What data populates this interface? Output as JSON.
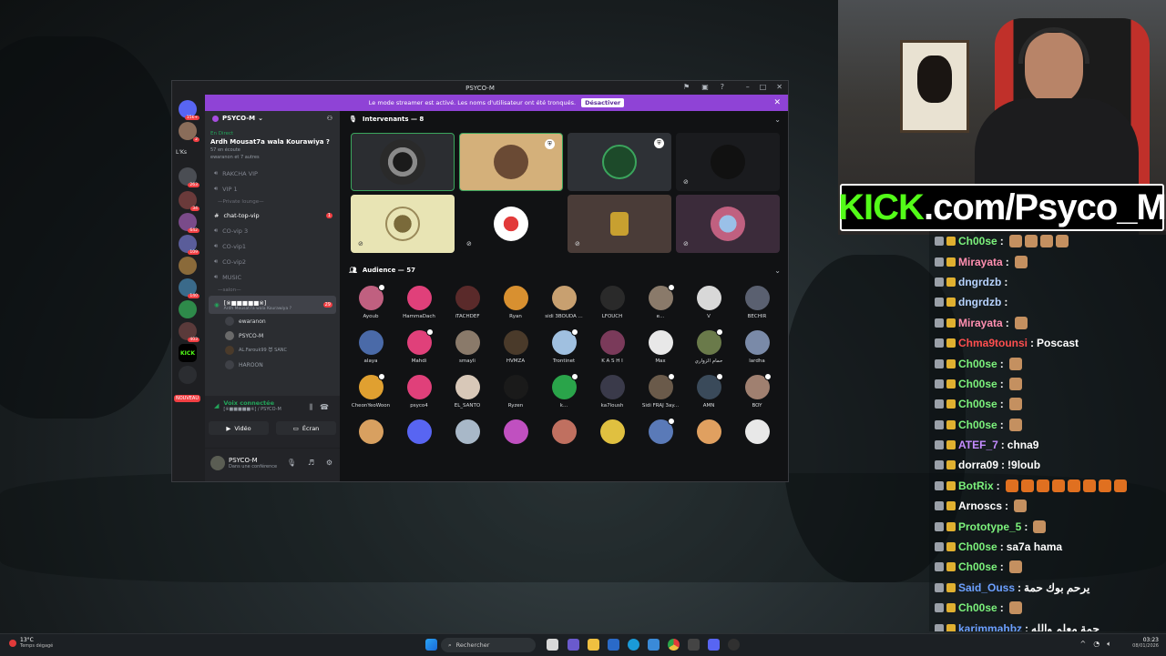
{
  "discord": {
    "title": "PSYCO-M",
    "banner_text": "Le mode streamer est activé. Les noms d'utilisateur ont été tronqués.",
    "banner_button": "Désactiver",
    "server_name": "PSYCO-M",
    "guild_labels": [
      "L'Ks"
    ],
    "guild_badges": [
      "15k+",
      "2",
      "263",
      "34",
      "642",
      "109",
      "140",
      "403",
      "39"
    ],
    "new_badge": "NOUVEAU",
    "event_live": "En Direct",
    "event_title": "Ardh Mousat7a wala Kourawiya ?",
    "event_listeners": "57 en écoute",
    "event_others": "ewaranon et 7 autres",
    "channels": [
      {
        "name": "RAKCHA VIP"
      },
      {
        "name": "VIP 1"
      },
      {
        "category": "Private lounge"
      },
      {
        "name": "chat-top-vip",
        "badge": "1"
      },
      {
        "name": "CO-vip 3"
      },
      {
        "name": "CO-vip1"
      },
      {
        "name": "CO-vip2"
      },
      {
        "name": "MUSIC"
      },
      {
        "category": "salon"
      }
    ],
    "stage_channel": {
      "name": "[※■■■■■※]",
      "badge": "29",
      "sub": "Ardh Mousat7a wala Kourawiya ?"
    },
    "voice_users": [
      "ewaranon",
      "PSYCO-M",
      "AL.Farouk99 😈 SANC",
      "HAROON"
    ],
    "voice_connected": "Voix connectée",
    "voice_sub": "[※■■■■■※] / PSYCO-M",
    "video_button": "Vidéo",
    "screen_button": "Écran",
    "user_name": "PSYCO-M",
    "user_status": "Dans une conférence",
    "speakers_header": "Intervenants — 8",
    "audience_header": "Audience — 57",
    "audience": [
      "Ayoub",
      "HammaDach",
      "iTACHDEF",
      "Ryan",
      "sidi 3BOUDA ...",
      "LFOUCH",
      "e...",
      "V",
      "BECHIR",
      "alaya",
      "Mahdi",
      "smayli",
      "HVMZA",
      "Trontinet",
      "K A S H I",
      "Max",
      "حمام الزواري",
      "lardha",
      "CheonYeoWoon",
      "psyco4",
      "EL_SANTO",
      "Ryzen",
      "k...",
      "ka7loush",
      "Sidi FRAJ 3ay...",
      "AMN",
      "BOY",
      "",
      "",
      "",
      "",
      "",
      "",
      "",
      "",
      ""
    ]
  },
  "kick_banner": {
    "prefix": "KICK",
    "rest": ".com/Psyco_M"
  },
  "chat": [
    {
      "user": "Ch00se",
      "text": "",
      "color": "#7cf27c",
      "emotes": 4
    },
    {
      "user": "Mirayata",
      "text": "",
      "color": "#ff8fb0",
      "emotes": 1
    },
    {
      "user": "dngrdzb",
      "text": "",
      "color": "#b8d4ff",
      "emotes": 0
    },
    {
      "user": "dngrdzb",
      "text": "",
      "color": "#b8d4ff",
      "emotes": 0
    },
    {
      "user": "Mirayata",
      "text": "",
      "color": "#ff8fb0",
      "emotes": 1
    },
    {
      "user": "Chma9tounsi",
      "text": "Poscast",
      "color": "#ff4f4f",
      "emotes": 0
    },
    {
      "user": "Ch00se",
      "text": "",
      "color": "#7cf27c",
      "emotes": 1
    },
    {
      "user": "Ch00se",
      "text": "",
      "color": "#7cf27c",
      "emotes": 1
    },
    {
      "user": "Ch00se",
      "text": "",
      "color": "#7cf27c",
      "emotes": 1
    },
    {
      "user": "Ch00se",
      "text": "",
      "color": "#7cf27c",
      "emotes": 1
    },
    {
      "user": "ATEF_7",
      "text": "chna9",
      "color": "#c48cff",
      "emotes": 0
    },
    {
      "user": "dorra09",
      "text": "!9loub",
      "color": "#ffffff",
      "emotes": 0
    },
    {
      "user": "BotRix",
      "text": "",
      "color": "#7cf27c",
      "emotes": 8
    },
    {
      "user": "Arnoscs",
      "text": "",
      "color": "#ffffff",
      "emotes": 1
    },
    {
      "user": "Prototype_5",
      "text": "",
      "color": "#7cf27c",
      "emotes": 1
    },
    {
      "user": "Ch00se",
      "text": "sa7a hama",
      "color": "#7cf27c",
      "emotes": 0
    },
    {
      "user": "Ch00se",
      "text": "",
      "color": "#7cf27c",
      "emotes": 1
    },
    {
      "user": "Said_Ouss",
      "text": "يرحم بوك حمة",
      "color": "#6ca0ff",
      "emotes": 0
    },
    {
      "user": "Ch00se",
      "text": "",
      "color": "#7cf27c",
      "emotes": 1
    },
    {
      "user": "karimmahbz",
      "text": "حمة معلم والله",
      "color": "#6ca0ff",
      "emotes": 0
    }
  ],
  "taskbar": {
    "weather_temp": "13°C",
    "weather_desc": "Temps dégagé",
    "search_placeholder": "Rechercher",
    "time": "03:23",
    "date": "08/01/2026"
  }
}
